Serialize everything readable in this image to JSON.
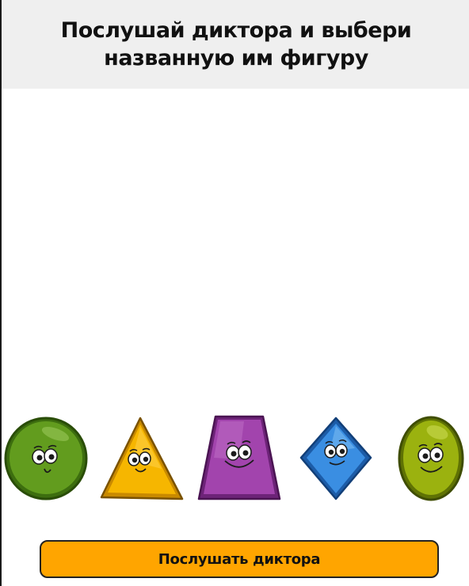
{
  "header": {
    "title": "Послушай диктора и выбери названную им фигуру"
  },
  "shapes": [
    {
      "name": "circle",
      "icon": "circle-character-icon",
      "color": "#5f9a1c"
    },
    {
      "name": "triangle",
      "icon": "triangle-character-icon",
      "color": "#f5b800"
    },
    {
      "name": "trapezoid",
      "icon": "trapezoid-character-icon",
      "color": "#9b3aa6"
    },
    {
      "name": "rhombus",
      "icon": "rhombus-character-icon",
      "color": "#2f86e0"
    },
    {
      "name": "oval",
      "icon": "oval-character-icon",
      "color": "#97b010"
    }
  ],
  "footer": {
    "button_label": "Послушать диктора",
    "button_color": "#ffa500"
  }
}
